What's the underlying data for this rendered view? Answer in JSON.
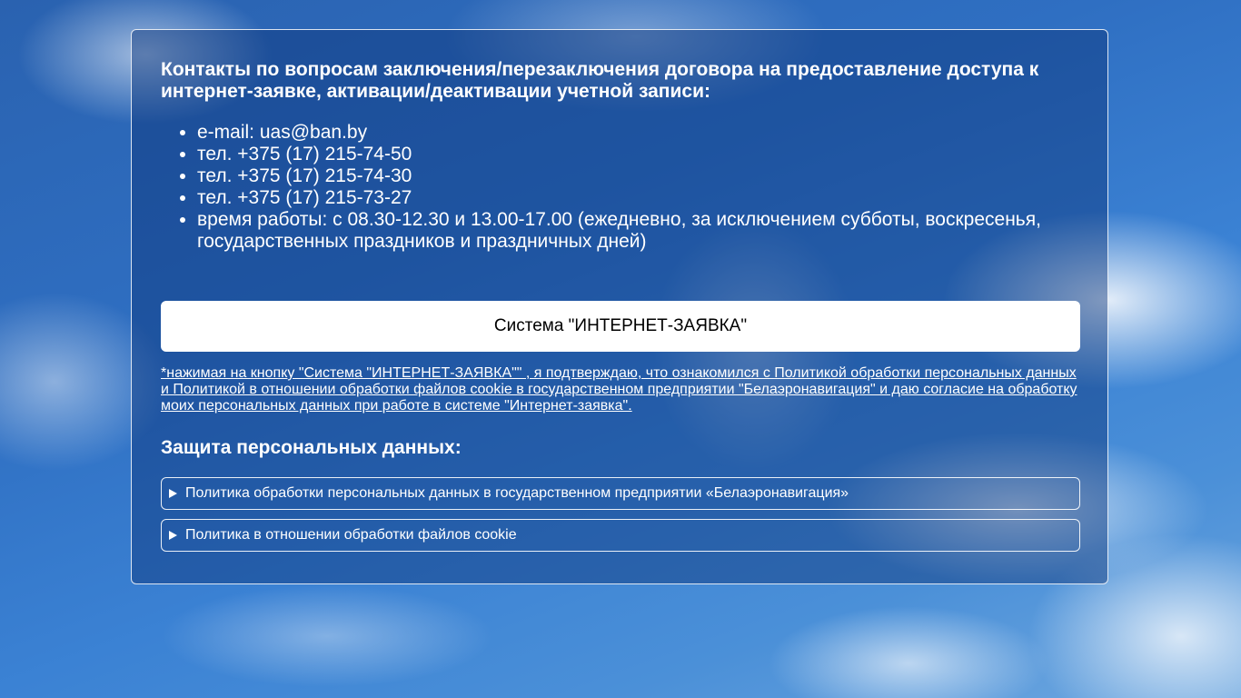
{
  "contacts": {
    "heading": "Контакты по вопросам заключения/перезаключения договора на предоставление доступа к интернет-заявке, активации/деактивации учетной записи:",
    "items": [
      "e-mail: uas@ban.by",
      "тел. +375 (17) 215-74-50",
      "тел. +375 (17) 215-74-30",
      "тел. +375 (17) 215-73-27",
      "время работы: с 08.30-12.30 и 13.00-17.00 (ежедневно, за исключением субботы, воскресенья, государственных праздников и праздничных дней)"
    ]
  },
  "system_button": {
    "label": "Система \"ИНТЕРНЕТ-ЗАЯВКА\""
  },
  "consent": {
    "text": "*нажимая на кнопку \"Система \"ИНТЕРНЕТ-ЗАЯВКА\"\" , я подтверждаю, что ознакомился с Политикой обработки персональных данных и Политикой в отношении обработки файлов cookie в государственном предприятии \"Белаэронавигация\" и даю согласие на обработку моих персональных данных при работе в системе \"Интернет-заявка\"."
  },
  "protection": {
    "heading": "Защита персональных данных:",
    "policies": [
      {
        "label": "Политика обработки персональных данных в государственном предприятии «Белаэронавигация»"
      },
      {
        "label": "Политика в отношении обработки файлов cookie"
      }
    ]
  }
}
